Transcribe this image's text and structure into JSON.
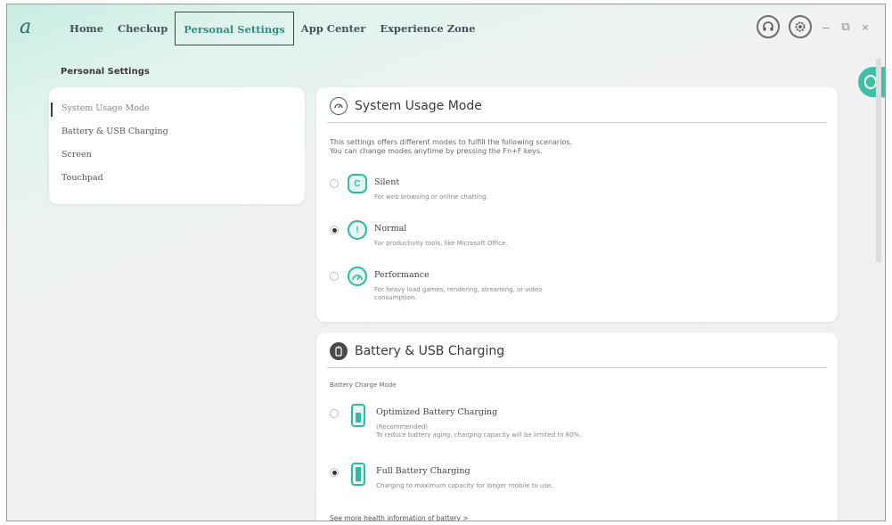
{
  "nav": {
    "items": [
      {
        "label": "Home",
        "active": false
      },
      {
        "label": "Checkup",
        "active": false
      },
      {
        "label": "Personal Settings",
        "active": true
      },
      {
        "label": "App Center",
        "active": false
      },
      {
        "label": "Experience Zone",
        "active": false
      }
    ],
    "window_controls": {
      "minimize": "–",
      "restore": "⧉",
      "close": "×"
    }
  },
  "page": {
    "title": "Personal Settings"
  },
  "sidebar": {
    "items": [
      {
        "label": "System Usage Mode",
        "active": true
      },
      {
        "label": "Battery & USB Charging",
        "active": false
      },
      {
        "label": "Screen",
        "active": false
      },
      {
        "label": "Touchpad",
        "active": false
      }
    ]
  },
  "system_usage": {
    "title": "System Usage Mode",
    "desc_line1": "This settings offers different modes to fulfill the following scenarios.",
    "desc_line2": "You can change modes anytime by pressing the Fn+F keys.",
    "options": [
      {
        "name": "Silent",
        "desc": "For web browsing or online chatting.",
        "selected": false,
        "icon": "leaf-icon"
      },
      {
        "name": "Normal",
        "desc": "For productivity tools, like Microsoft Office.",
        "selected": true,
        "icon": "gauge-icon"
      },
      {
        "name": "Performance",
        "desc_line1": "For heavy load games, rendering, streaming, or video",
        "desc_line2": "consumption.",
        "selected": false,
        "icon": "speedometer-icon"
      }
    ]
  },
  "battery": {
    "title": "Battery & USB Charging",
    "section_label": "Battery Charge Mode",
    "options": [
      {
        "name": "Optimized Battery Charging",
        "desc_line1": "(Recommended)",
        "desc_line2": "To reduce battery aging, charging capacity will be limited to 80%.",
        "selected": false
      },
      {
        "name": "Full Battery Charging",
        "desc": "Charging to maximum capacity for longer mobile to use.",
        "selected": true
      }
    ],
    "link": "See more health information of battery >"
  },
  "colors": {
    "accent": "#2fb9a1",
    "float_button": "#3fbfa6"
  }
}
